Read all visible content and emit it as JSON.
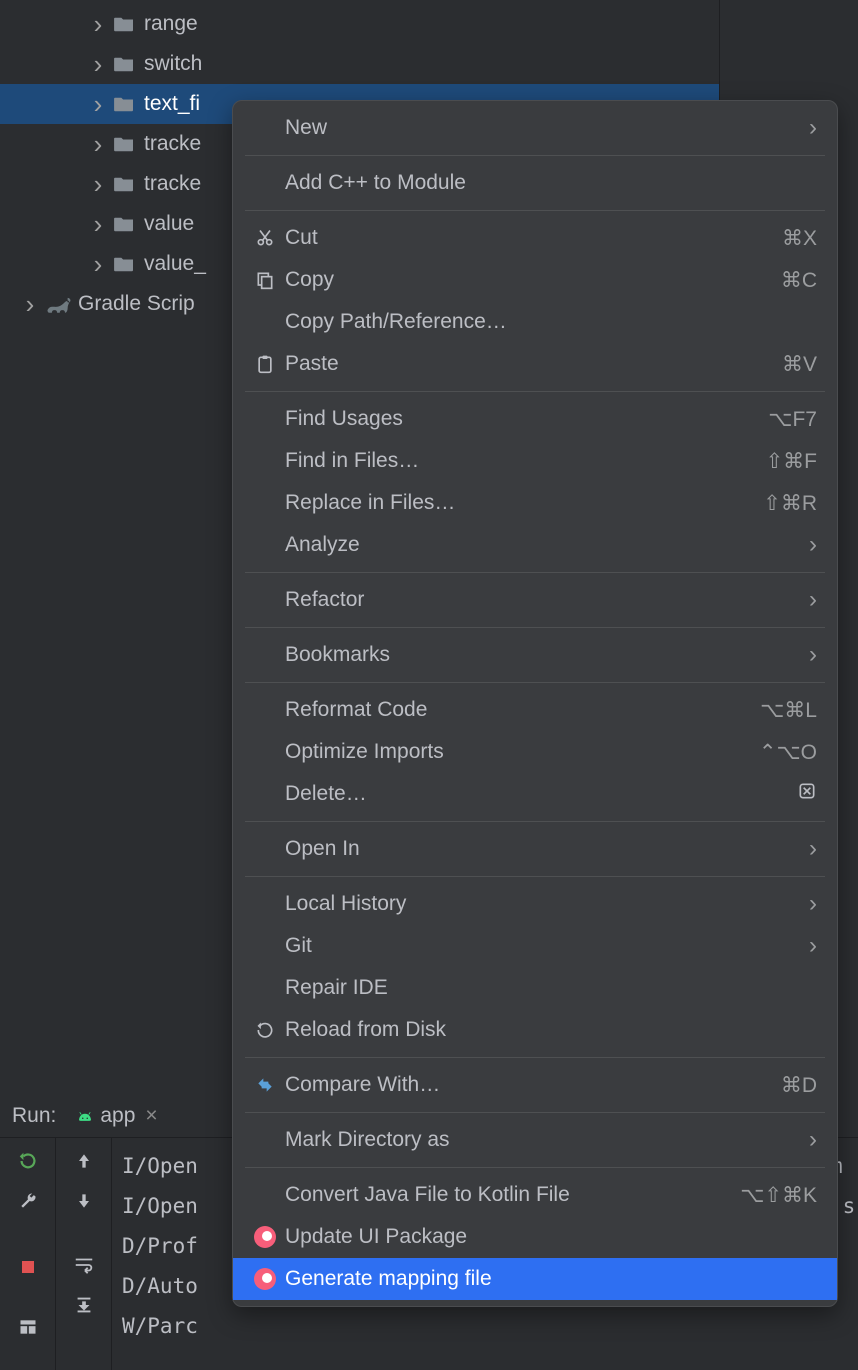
{
  "tree": {
    "items": [
      {
        "label": "range",
        "indent": 1,
        "selected": false
      },
      {
        "label": "switch",
        "indent": 1,
        "selected": false
      },
      {
        "label": "text_fi",
        "indent": 1,
        "selected": true
      },
      {
        "label": "tracke",
        "indent": 1,
        "selected": false
      },
      {
        "label": "tracke",
        "indent": 1,
        "selected": false
      },
      {
        "label": "value",
        "indent": 1,
        "selected": false
      },
      {
        "label": "value_",
        "indent": 1,
        "selected": false
      }
    ],
    "gradle_label": "Gradle Scrip"
  },
  "context_menu": {
    "items": [
      {
        "label": "New",
        "icon": "",
        "shortcut": "",
        "arrow": true
      },
      {
        "sep": true
      },
      {
        "label": "Add C++ to Module",
        "icon": "",
        "shortcut": "",
        "arrow": false
      },
      {
        "sep": true
      },
      {
        "label": "Cut",
        "icon": "cut",
        "shortcut": "⌘X",
        "arrow": false
      },
      {
        "label": "Copy",
        "icon": "copy",
        "shortcut": "⌘C",
        "arrow": false
      },
      {
        "label": "Copy Path/Reference…",
        "icon": "",
        "shortcut": "",
        "arrow": false
      },
      {
        "label": "Paste",
        "icon": "paste",
        "shortcut": "⌘V",
        "arrow": false
      },
      {
        "sep": true
      },
      {
        "label": "Find Usages",
        "icon": "",
        "shortcut": "⌥F7",
        "arrow": false
      },
      {
        "label": "Find in Files…",
        "icon": "",
        "shortcut": "⇧⌘F",
        "arrow": false
      },
      {
        "label": "Replace in Files…",
        "icon": "",
        "shortcut": "⇧⌘R",
        "arrow": false
      },
      {
        "label": "Analyze",
        "icon": "",
        "shortcut": "",
        "arrow": true
      },
      {
        "sep": true
      },
      {
        "label": "Refactor",
        "icon": "",
        "shortcut": "",
        "arrow": true
      },
      {
        "sep": true
      },
      {
        "label": "Bookmarks",
        "icon": "",
        "shortcut": "",
        "arrow": true
      },
      {
        "sep": true
      },
      {
        "label": "Reformat Code",
        "icon": "",
        "shortcut": "⌥⌘L",
        "arrow": false
      },
      {
        "label": "Optimize Imports",
        "icon": "",
        "shortcut": "⌃⌥O",
        "arrow": false
      },
      {
        "label": "Delete…",
        "icon": "",
        "shortcut": "",
        "arrow": false,
        "trail_icon": "delete"
      },
      {
        "sep": true
      },
      {
        "label": "Open In",
        "icon": "",
        "shortcut": "",
        "arrow": true
      },
      {
        "sep": true
      },
      {
        "label": "Local History",
        "icon": "",
        "shortcut": "",
        "arrow": true
      },
      {
        "label": "Git",
        "icon": "",
        "shortcut": "",
        "arrow": true
      },
      {
        "label": "Repair IDE",
        "icon": "",
        "shortcut": "",
        "arrow": false
      },
      {
        "label": "Reload from Disk",
        "icon": "reload",
        "shortcut": "",
        "arrow": false
      },
      {
        "sep": true
      },
      {
        "label": "Compare With…",
        "icon": "compare",
        "shortcut": "⌘D",
        "arrow": false
      },
      {
        "sep": true
      },
      {
        "label": "Mark Directory as",
        "icon": "",
        "shortcut": "",
        "arrow": true
      },
      {
        "sep": true
      },
      {
        "label": "Convert Java File to Kotlin File",
        "icon": "",
        "shortcut": "⌥⇧⌘K",
        "arrow": false
      },
      {
        "label": "Update UI Package",
        "icon": "relay",
        "shortcut": "",
        "arrow": false
      },
      {
        "label": "Generate mapping file",
        "icon": "relay",
        "shortcut": "",
        "arrow": false,
        "highlighted": true
      }
    ]
  },
  "run": {
    "title": "Run:",
    "tab": {
      "label": "app",
      "close": "×"
    },
    "logs": [
      "I/Open",
      "I/Open",
      "D/Prof",
      "D/Auto",
      "W/Parc"
    ],
    "logs_right": [
      "m",
      ".s"
    ]
  }
}
